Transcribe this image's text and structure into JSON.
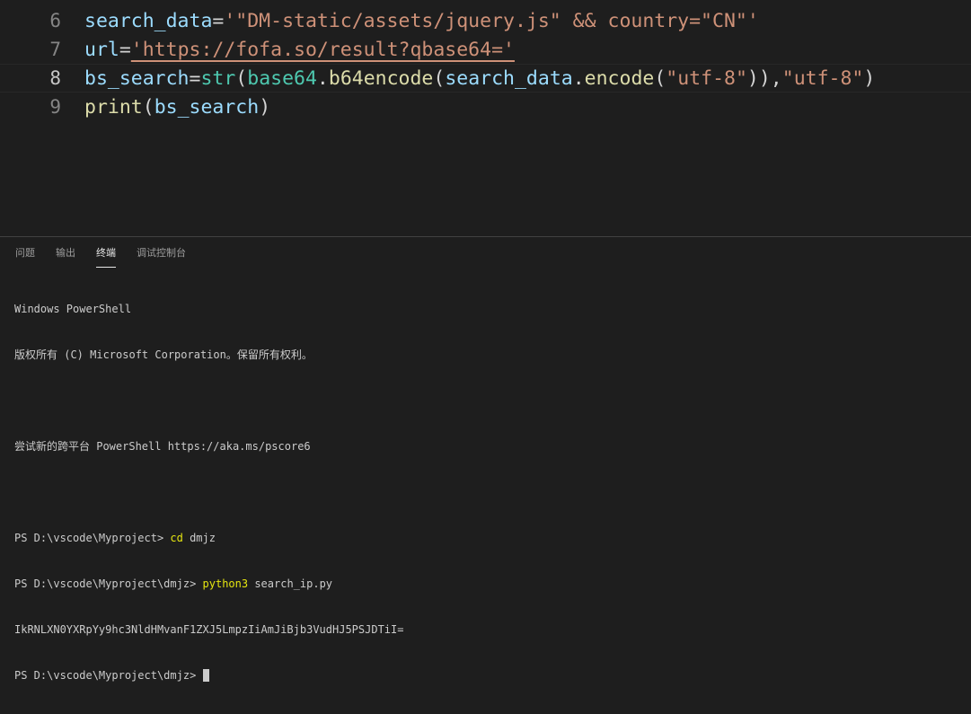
{
  "editor": {
    "lines": [
      {
        "number": "6"
      },
      {
        "number": "7"
      },
      {
        "number": "8"
      },
      {
        "number": "9"
      }
    ],
    "line6": {
      "var": "search_data",
      "op": "=",
      "str": "'\"DM-static/assets/jquery.js\" && country=\"CN\"'"
    },
    "line7": {
      "var": "url",
      "op": "=",
      "str": "'https://fofa.so/result?qbase64='"
    },
    "line8": {
      "var": "bs_search",
      "op": "=",
      "fn_str": "str",
      "p1": "(",
      "mod": "base64",
      "dot1": ".",
      "fn_enc": "b64encode",
      "p2": "(",
      "arg": "search_data",
      "dot2": ".",
      "fn_encode": "encode",
      "p3": "(",
      "s1": "\"utf-8\"",
      "p4": ")),",
      "s2": "\"utf-8\"",
      "p5": ")"
    },
    "line9": {
      "fn": "print",
      "p1": "(",
      "arg": "bs_search",
      "p2": ")"
    }
  },
  "panel": {
    "tabs": [
      {
        "label": "问题"
      },
      {
        "label": "输出"
      },
      {
        "label": "终端"
      },
      {
        "label": "调试控制台"
      }
    ],
    "terminal": {
      "l1": "Windows PowerShell",
      "l2": "版权所有 (C) Microsoft Corporation。保留所有权利。",
      "l3": "",
      "l4": "尝试新的跨平台 PowerShell https://aka.ms/pscore6",
      "l5": "",
      "l6_prompt": "PS D:\\vscode\\Myproject> ",
      "l6_cmd": "cd",
      "l6_arg": " dmjz",
      "l7_prompt": "PS D:\\vscode\\Myproject\\dmjz> ",
      "l7_cmd": "python3",
      "l7_arg": " search_ip.py",
      "l8": "IkRNLXN0YXRpYy9hc3NldHMvanF1ZXJ5LmpzIiAmJiBjb3VudHJ5PSJDTiI=",
      "l9_prompt": "PS D:\\vscode\\Myproject\\dmjz> "
    }
  },
  "colors": {
    "background": "#1e1e1e",
    "variable": "#9cdcfe",
    "string": "#ce9178",
    "function": "#dcdcaa",
    "class": "#4ec9b0",
    "command": "#e5e510"
  }
}
